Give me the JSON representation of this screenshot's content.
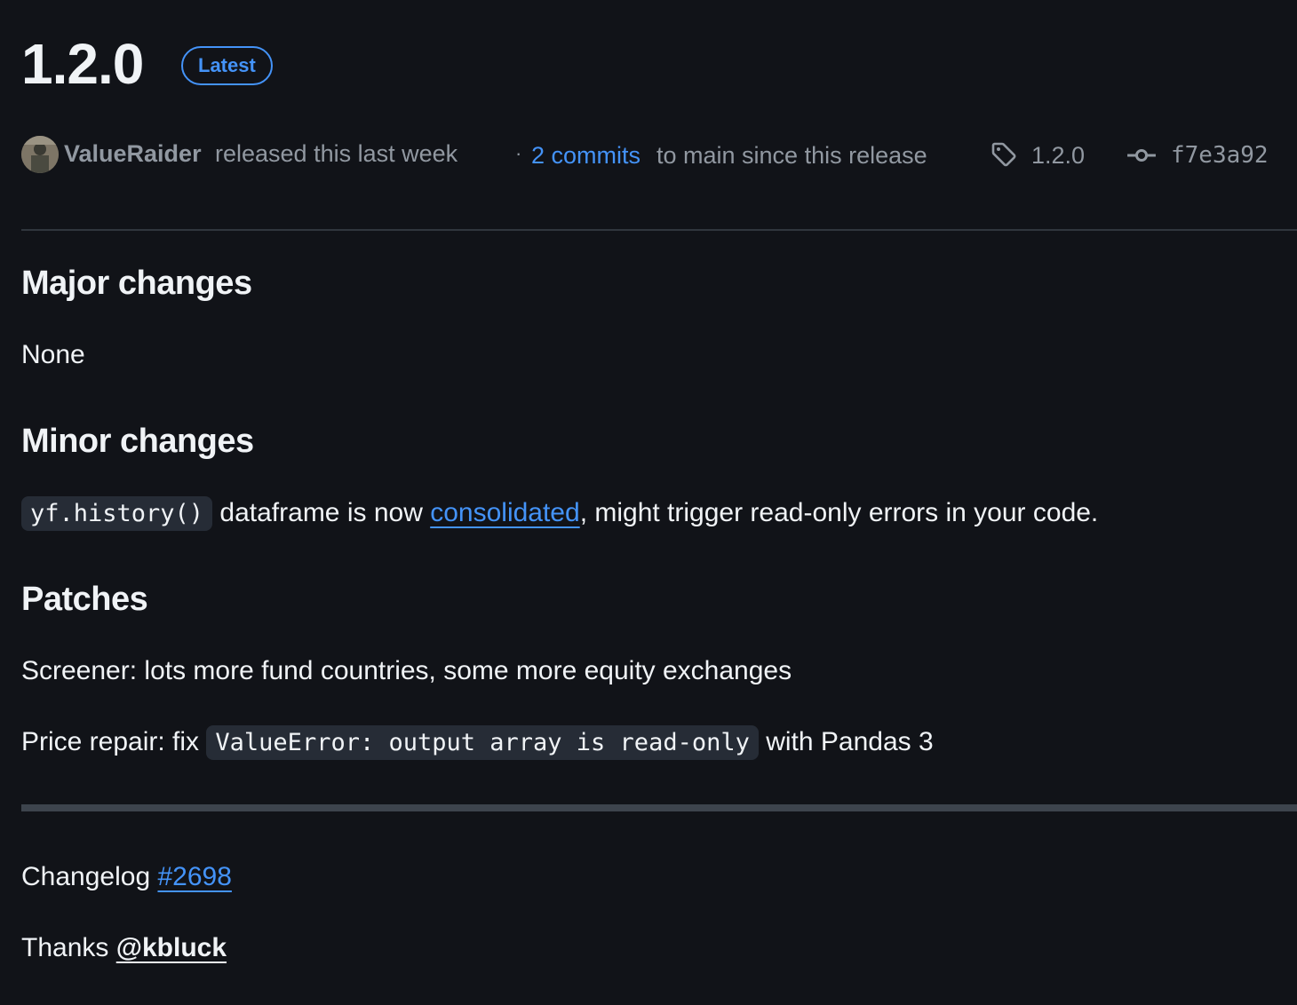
{
  "release": {
    "title": "1.2.0",
    "badge": "Latest"
  },
  "meta": {
    "author": "ValueRaider",
    "released_text": "released this last week",
    "separator": "·",
    "commits_link": "2 commits",
    "commits_suffix": "to main since this release",
    "tag": "1.2.0",
    "commit_sha": "f7e3a92"
  },
  "body": {
    "major": {
      "heading": "Major changes",
      "text": "None"
    },
    "minor": {
      "heading": "Minor changes",
      "code": "yf.history()",
      "text_before_link": "dataframe is now",
      "link": "consolidated",
      "text_after_link": ", might trigger read-only errors in your code."
    },
    "patches": {
      "heading": "Patches",
      "item1": "Screener: lots more fund countries, some more equity exchanges",
      "item2_before": "Price repair: fix",
      "item2_code": "ValueError: output array is read-only",
      "item2_after": "with Pandas 3"
    },
    "changelog": {
      "label": "Changelog",
      "link": "#2698"
    },
    "thanks": {
      "label": "Thanks",
      "user": "@kbluck"
    }
  }
}
